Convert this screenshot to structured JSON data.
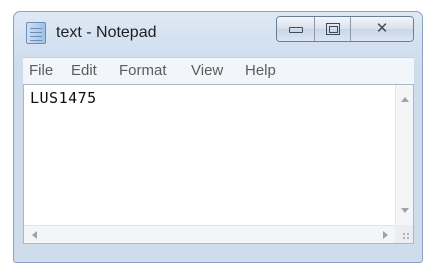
{
  "window": {
    "title": "text - Notepad",
    "icons": {
      "app": "notepad-icon",
      "minimize": "minimize-icon",
      "maximize": "maximize-icon",
      "close": "close-icon"
    },
    "close_glyph": "☒"
  },
  "menu": {
    "items": [
      {
        "label": "File"
      },
      {
        "label": "Edit"
      },
      {
        "label": "Format"
      },
      {
        "label": "View"
      },
      {
        "label": "Help"
      }
    ]
  },
  "editor": {
    "content": "LUS1475"
  },
  "scrollbars": {
    "icons": {
      "up": "scroll-up-arrow-icon",
      "down": "scroll-down-arrow-icon",
      "left": "scroll-left-arrow-icon",
      "right": "scroll-right-arrow-icon",
      "grip": "size-grip-icon"
    }
  },
  "colors": {
    "frame": "#d3e1f1",
    "border": "#8aa4c0",
    "menubar": "#f2f5fa",
    "editor_bg": "#ffffff",
    "text": "#101010"
  }
}
